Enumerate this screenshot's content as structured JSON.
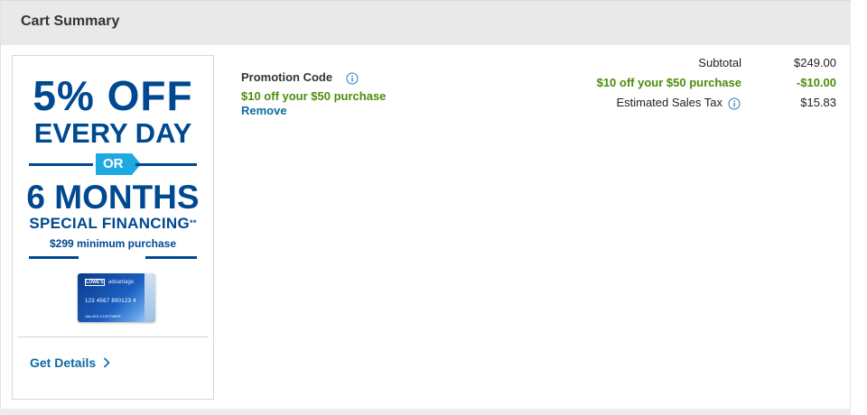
{
  "header": {
    "title": "Cart Summary"
  },
  "promo_ad": {
    "line1": "5% OFF",
    "line2": "EVERY DAY",
    "or": "OR",
    "line4": "6 MONTHS",
    "line5": "SPECIAL FINANCING",
    "line5_mark": "**",
    "line6": "$299 minimum purchase",
    "card": {
      "logo": "LOWE'S",
      "brand": "advantage",
      "number": "123 4567 890123 4",
      "holder": "VALUED CUSTOMER"
    },
    "cta": "Get Details"
  },
  "promotion_code": {
    "label": "Promotion Code",
    "applied": "$10 off your $50 purchase",
    "remove": "Remove"
  },
  "summary": {
    "subtotal_label": "Subtotal",
    "subtotal_value": "$249.00",
    "discount_label": "$10 off your $50 purchase",
    "discount_value": "-$10.00",
    "tax_label": "Estimated Sales Tax",
    "tax_value": "$15.83"
  },
  "colors": {
    "brand_blue": "#004990",
    "accent_blue": "#1fa9e1",
    "link_blue": "#0b6aa2",
    "promo_green": "#4c8c0a",
    "header_bg": "#e9e9e9"
  },
  "icons": [
    "info-icon",
    "chevron-right-icon"
  ]
}
